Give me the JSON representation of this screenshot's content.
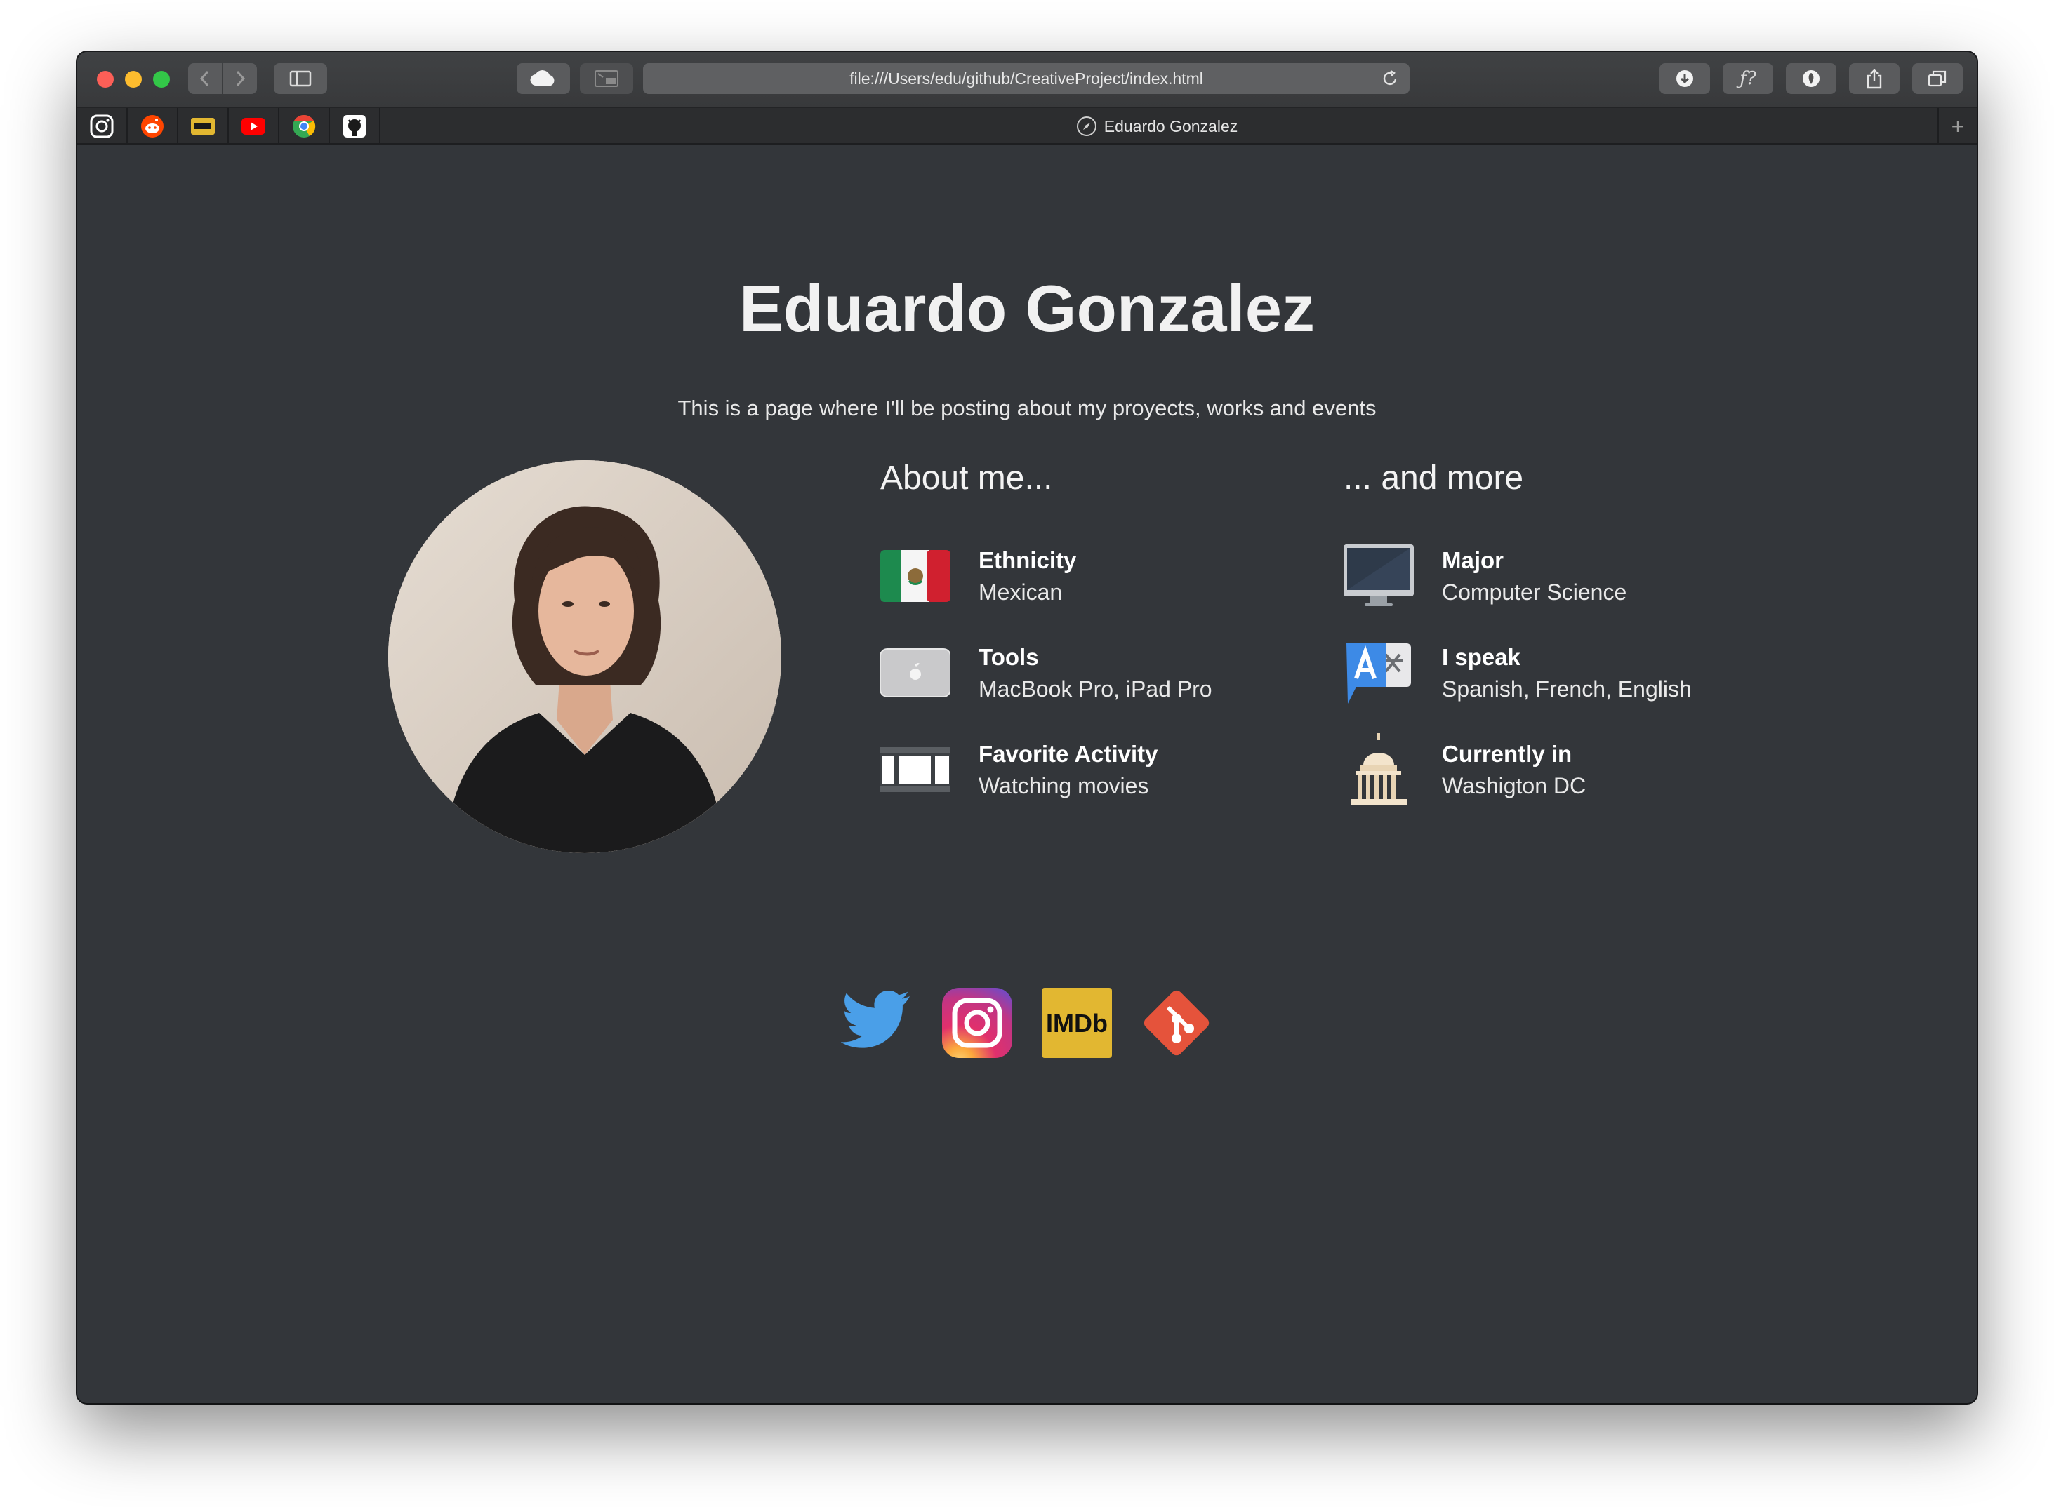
{
  "browser": {
    "url": "file:///Users/edu/github/CreativeProject/index.html",
    "tab_title": "Eduardo Gonzalez",
    "favorites": [
      "instagram-icon",
      "reddit-icon",
      "imdb-icon",
      "youtube-icon",
      "chrome-icon",
      "github-icon"
    ],
    "toolbar_font_button": "ƒ?"
  },
  "page": {
    "title": "Eduardo Gonzalez",
    "subtitle": "This is a page where I'll be posting about my proyects, works and events",
    "about": {
      "heading": "About me...",
      "items": [
        {
          "label": "Ethnicity",
          "value": "Mexican",
          "icon": "mexico-flag-icon"
        },
        {
          "label": "Tools",
          "value": "MacBook Pro, iPad Pro",
          "icon": "macbook-icon"
        },
        {
          "label": "Favorite Activity",
          "value": "Watching movies",
          "icon": "film-strip-icon"
        }
      ]
    },
    "more": {
      "heading": "... and more",
      "items": [
        {
          "label": "Major",
          "value": "Computer Science",
          "icon": "monitor-icon"
        },
        {
          "label": "I speak",
          "value": "Spanish, French, English",
          "icon": "translate-icon"
        },
        {
          "label": "Currently in",
          "value": "Washigton DC",
          "icon": "capitol-icon"
        }
      ]
    },
    "social": {
      "imdb_text": "IMDb",
      "links": [
        "twitter-icon",
        "instagram-icon",
        "imdb-icon",
        "git-icon"
      ]
    }
  },
  "colors": {
    "page_bg": "#33363a",
    "twitter": "#4a9fe8",
    "imdb": "#e2b731",
    "git": "#e5533b"
  }
}
